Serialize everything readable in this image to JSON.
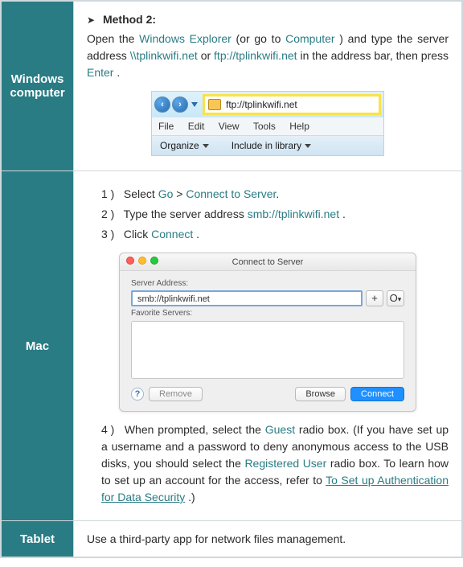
{
  "rows": {
    "windows": {
      "label_l1": "Windows",
      "label_l2": "computer"
    },
    "mac": {
      "label": "Mac"
    },
    "tablet": {
      "label": "Tablet",
      "content": "Use a third-party app for network files management."
    }
  },
  "win": {
    "method": "Method 2:",
    "text_a": "Open the ",
    "link_explorer": "Windows Explorer",
    "text_b": " (or go to ",
    "link_computer": "Computer",
    "text_c": ") and type the server address ",
    "addr1": "\\\\tplinkwifi.net",
    "text_d": " or ",
    "addr2": "ftp://tplinkwifi.net",
    "text_e": " in the address bar, then press ",
    "enter": "Enter",
    "text_f": ".",
    "shot": {
      "addr": "ftp://tplinkwifi.net",
      "menu": [
        "File",
        "Edit",
        "View",
        "Tools",
        "Help"
      ],
      "organize": "Organize",
      "include": "Include in library"
    }
  },
  "mac": {
    "s1_a": "Select ",
    "s1_go": "Go",
    "s1_gt": " > ",
    "s1_cts": "Connect to Server",
    "s2_a": "Type the server address ",
    "s2_addr": "smb://tplinkwifi.net",
    "s2_b": ".",
    "s3_a": "Click ",
    "s3_connect": "Connect",
    "s3_b": ".",
    "s4_a": "When prompted, select the ",
    "s4_guest": "Guest",
    "s4_b": " radio box. (If you have set up a username and a password to deny anonymous access to the USB disks, you should select the ",
    "s4_reg": "Registered User",
    "s4_c": " radio box. To learn how to set up an account for the access, refer to ",
    "s4_link": "To Set up Authentication for Data Security",
    "s4_d": ".)",
    "shot": {
      "title": "Connect to Server",
      "server_address": "Server Address:",
      "addr_value": "smb://tplinkwifi.net",
      "plus": "+",
      "clock": "O",
      "fav": "Favorite Servers:",
      "help": "?",
      "remove": "Remove",
      "browse": "Browse",
      "connect": "Connect"
    }
  },
  "nums": {
    "n1": "1 )",
    "n2": "2 )",
    "n3": "3 )",
    "n4": "4 )"
  }
}
